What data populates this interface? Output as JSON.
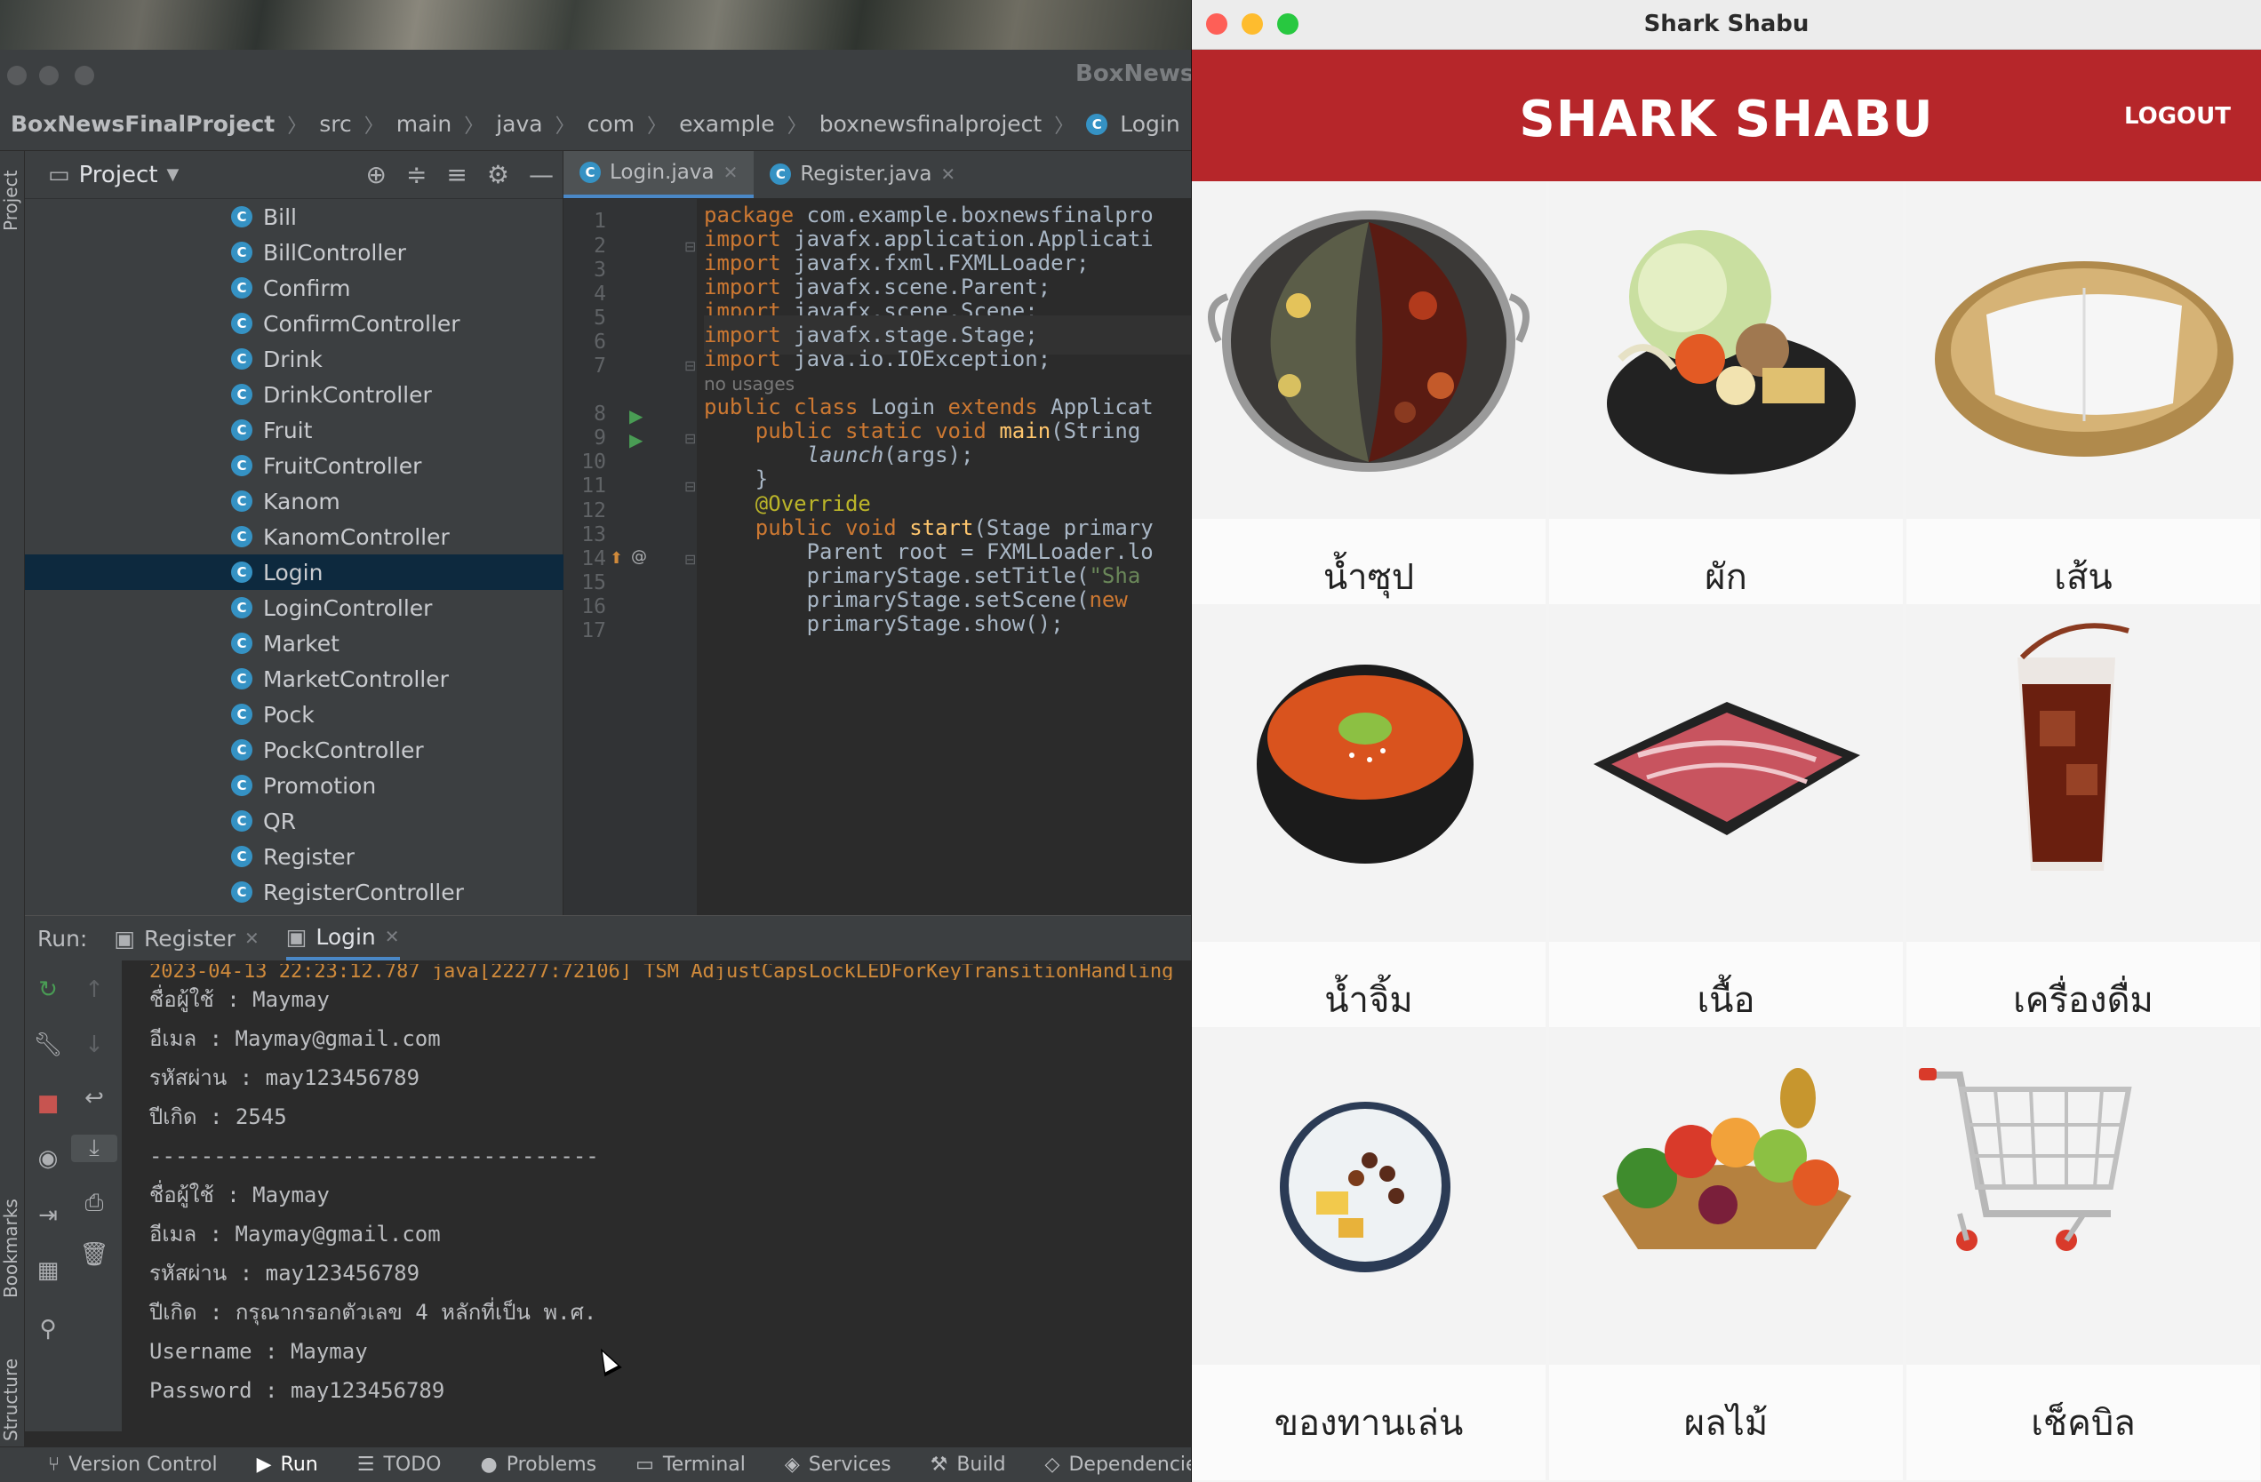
{
  "ide": {
    "window_title": "BoxNewsF",
    "breadcrumb": [
      "BoxNewsFinalProject",
      "src",
      "main",
      "java",
      "com",
      "example",
      "boxnewsfinalproject",
      "Login"
    ],
    "project_panel": {
      "title": "Project",
      "side_tabs": {
        "project": "Project",
        "bookmarks": "Bookmarks",
        "structure": "Structure"
      },
      "items": [
        "Bill",
        "BillController",
        "Confirm",
        "ConfirmController",
        "Drink",
        "DrinkController",
        "Fruit",
        "FruitController",
        "Kanom",
        "KanomController",
        "Login",
        "LoginController",
        "Market",
        "MarketController",
        "Pock",
        "PockController",
        "Promotion",
        "QR",
        "Register",
        "RegisterController"
      ],
      "selected": "Login"
    },
    "editor": {
      "tabs": [
        {
          "label": "Login.java",
          "active": true
        },
        {
          "label": "Register.java",
          "active": false
        }
      ],
      "line_numbers": [
        "1",
        "2",
        "3",
        "4",
        "5",
        "6",
        "7",
        "8",
        "9",
        "10",
        "11",
        "12",
        "13",
        "14",
        "15",
        "16",
        "17"
      ],
      "code": {
        "l1_kw": "package",
        "l1_rest": " com.example.boxnewsfinalpro",
        "l2_kw": "import",
        "l2_rest": " javafx.application.Applicati",
        "l3_kw": "import",
        "l3_rest": " javafx.fxml.FXMLLoader;",
        "l4_kw": "import",
        "l4_rest": " javafx.scene.Parent;",
        "l5_kw": "import",
        "l5_rest": " javafx.scene.Scene;",
        "l6_kw": "import",
        "l6_rest": " javafx.stage.Stage;",
        "l7_kw": "import",
        "l7_rest": " java.io.IOException;",
        "hint": "no usages",
        "l8_kw1": "public class",
        "l8_name": " Login ",
        "l8_kw2": "extends",
        "l8_rest": " Applicat",
        "l9_kw": "    public static void ",
        "l9_fn": "main",
        "l9_rest": "(String",
        "l10_it": "        launch",
        "l10_rest": "(args);",
        "l11": "    }",
        "l12_an": "    @Override",
        "l13_kw": "    public void ",
        "l13_fn": "start",
        "l13_rest": "(Stage primary",
        "l14": "        Parent root = FXMLLoader.lo",
        "l15_a": "        primaryStage.setTitle(",
        "l15_st": "\"Sha",
        "l16_a": "        primaryStage.setScene(",
        "l16_kw": "new ",
        "l17": "        primaryStage.show();"
      }
    },
    "run_panel": {
      "label": "Run:",
      "tabs": [
        {
          "label": "Register",
          "active": false
        },
        {
          "label": "Login",
          "active": true
        }
      ],
      "truncated_line": "2023-04-13 22:23:12.787 java[22277:72106] TSM AdjustCapsLockLEDForKeyTransitionHandling",
      "console": [
        "ชื่อผู้ใช้ : Maymay",
        "อีเมล : Maymay@gmail.com",
        "รหัสผ่าน : may123456789",
        "ปีเกิด : 2545",
        "-----------------------------------",
        "ชื่อผู้ใช้ : Maymay",
        "อีเมล : Maymay@gmail.com",
        "รหัสผ่าน : may123456789",
        "ปีเกิด : กรุณากรอกตัวเลข 4 หลักที่เป็น พ.ศ.",
        "Username : Maymay",
        "Password : may123456789"
      ]
    },
    "status_bar": {
      "version_control": "Version Control",
      "run": "Run",
      "todo": "TODO",
      "problems": "Problems",
      "terminal": "Terminal",
      "services": "Services",
      "build": "Build",
      "dependencies": "Dependencie"
    }
  },
  "app": {
    "window_title": "Shark Shabu",
    "brand": "SHARK SHABU",
    "logout_label": "LOGOUT",
    "header_color": "#b6262a",
    "menu": [
      {
        "label": "น้ำซุป",
        "icon": "soup-pot-icon"
      },
      {
        "label": "ผัก",
        "icon": "vegetables-icon"
      },
      {
        "label": "เส้น",
        "icon": "noodles-icon"
      },
      {
        "label": "น้ำจิ้ม",
        "icon": "dipping-sauce-icon"
      },
      {
        "label": "เนื้อ",
        "icon": "meat-tray-icon"
      },
      {
        "label": "เครื่องดื่ม",
        "icon": "iced-drink-icon"
      },
      {
        "label": "ของทานเล่น",
        "icon": "dessert-bowl-icon"
      },
      {
        "label": "ผลไม้",
        "icon": "fruit-basket-icon"
      },
      {
        "label": "เช็คบิล",
        "icon": "shopping-cart-icon"
      }
    ]
  }
}
